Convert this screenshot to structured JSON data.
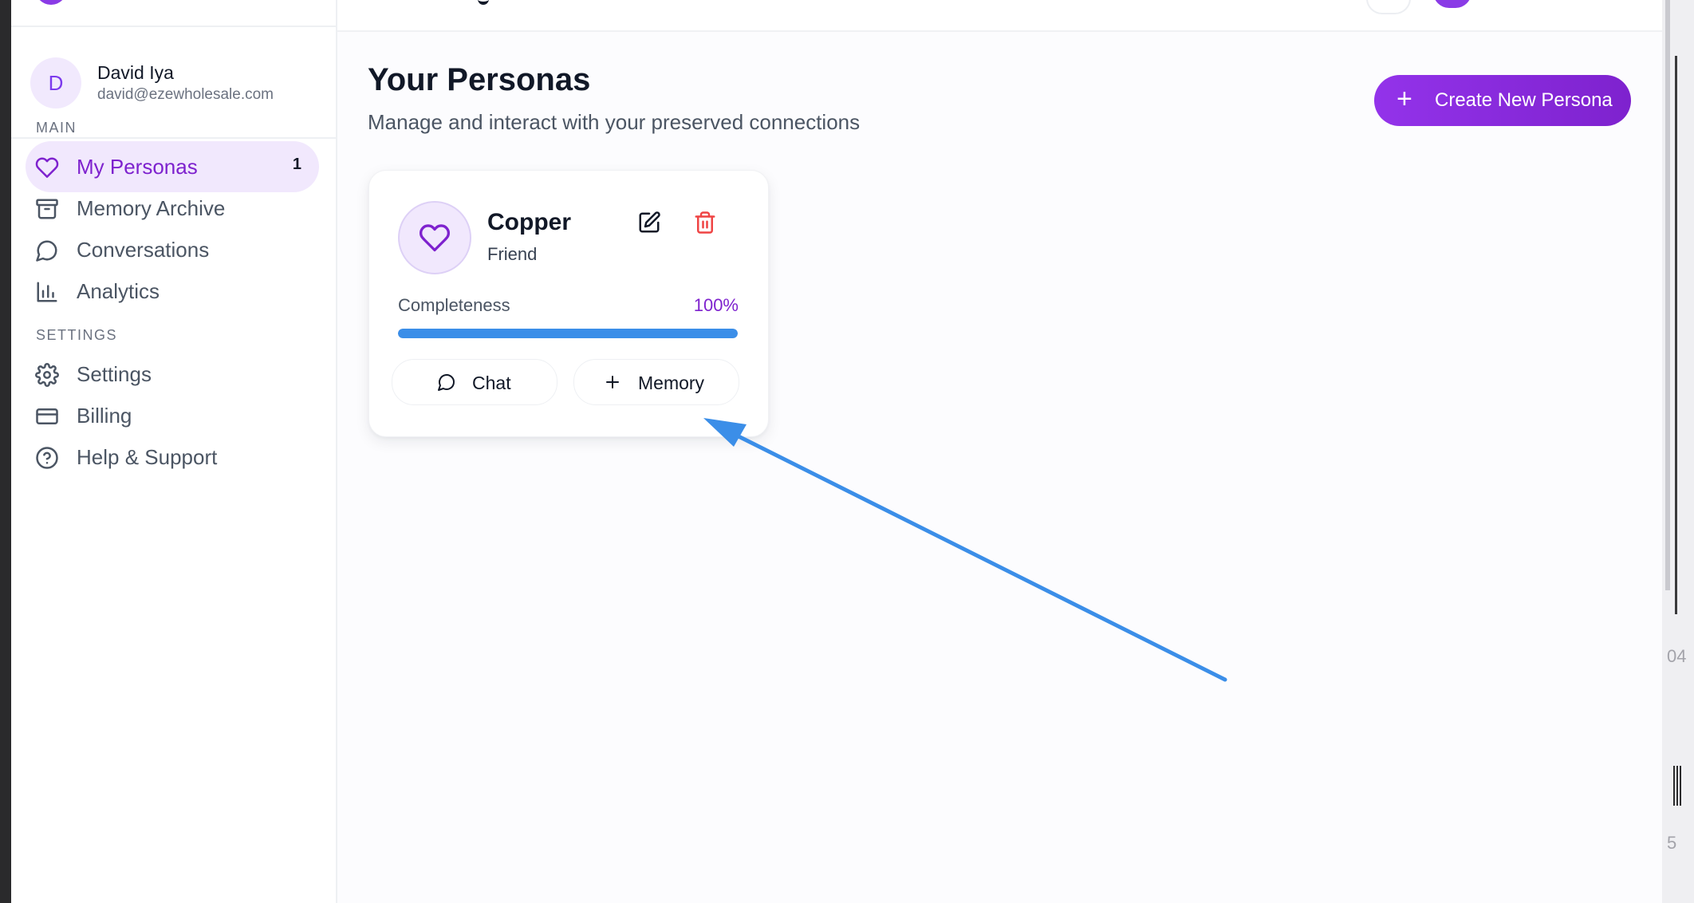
{
  "colors": {
    "accent": "#7e22ce",
    "accent_bg": "#f1e8fd",
    "progress": "#3b8ee8",
    "delete": "#ef4444",
    "annotation_arrow": "#3b8ee8"
  },
  "sidebar": {
    "user": {
      "initial": "D",
      "name": "David Iya",
      "email": "david@ezewholesale.com"
    },
    "main_section_label": "MAIN",
    "main_items": [
      {
        "label": "My Personas",
        "icon": "heart-icon",
        "badge": "1",
        "active": true
      },
      {
        "label": "Memory Archive",
        "icon": "archive-icon"
      },
      {
        "label": "Conversations",
        "icon": "chat-bubble-icon"
      },
      {
        "label": "Analytics",
        "icon": "bar-chart-icon"
      }
    ],
    "settings_section_label": "SETTINGS",
    "settings_items": [
      {
        "label": "Settings",
        "icon": "gear-icon"
      },
      {
        "label": "Billing",
        "icon": "credit-card-icon"
      },
      {
        "label": "Help & Support",
        "icon": "help-circle-icon"
      }
    ]
  },
  "main": {
    "title": "Your Personas",
    "subtitle": "Manage and interact with your preserved connections",
    "create_button_label": "Create New Persona",
    "persona": {
      "name": "Copper",
      "role": "Friend",
      "avatar_icon": "heart-icon",
      "completeness_label": "Completeness",
      "completeness_value": "100%",
      "completeness_fraction": 1.0,
      "chat_button_label": "Chat",
      "memory_button_label": "Memory"
    }
  },
  "edge": {
    "text_a": "04",
    "text_b": "5"
  }
}
